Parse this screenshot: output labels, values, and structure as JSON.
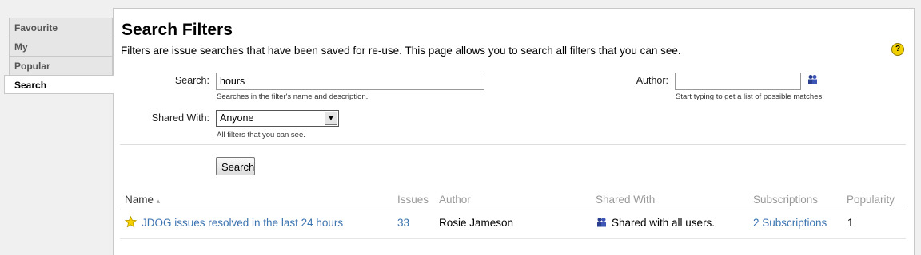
{
  "tabs": [
    {
      "label": "Favourite",
      "active": false
    },
    {
      "label": "My",
      "active": false
    },
    {
      "label": "Popular",
      "active": false
    },
    {
      "label": "Search",
      "active": true
    }
  ],
  "page": {
    "title": "Search Filters",
    "description": "Filters are issue searches that have been saved for re-use. This page allows you to search all filters that you can see.",
    "help_icon": "question-mark-icon"
  },
  "form": {
    "search_label": "Search:",
    "search_value": "hours",
    "search_hint": "Searches in the filter's name and description.",
    "author_label": "Author:",
    "author_value": "",
    "author_hint": "Start typing to get a list of possible matches.",
    "shared_label": "Shared With:",
    "shared_value": "Anyone",
    "shared_hint": "All filters that you can see.",
    "search_button": "Search"
  },
  "table": {
    "headers": {
      "name": "Name",
      "sort_indicator": "▴",
      "issues": "Issues",
      "author": "Author",
      "shared_with": "Shared With",
      "subscriptions": "Subscriptions",
      "popularity": "Popularity"
    },
    "rows": [
      {
        "name": "JDOG issues resolved in the last 24 hours",
        "issues": "33",
        "author": "Rosie Jameson",
        "shared_with": "Shared with all users.",
        "subscriptions": "2 Subscriptions",
        "popularity": "1",
        "favourite": true
      }
    ]
  },
  "colors": {
    "link": "#3b73af",
    "star": "#f5d000",
    "help": "#f2d100"
  }
}
